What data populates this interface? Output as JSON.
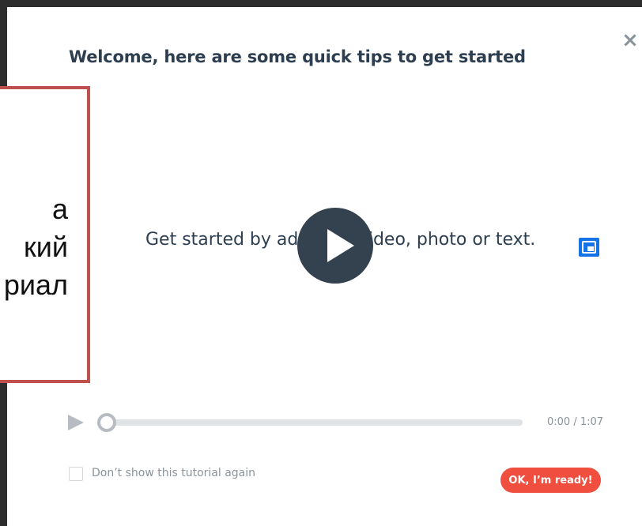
{
  "modal": {
    "title": "Welcome, here are some quick tips to get started",
    "close_icon": "close-icon"
  },
  "video": {
    "caption": "Get started by adding a video, photo or text.",
    "play_icon": "play-icon",
    "pip_icon": "picture-in-picture-icon",
    "progress": 0,
    "time": "0:00 / 1:07"
  },
  "overlay": {
    "text": "а\nкий\nриал",
    "border_color": "#c0504d"
  },
  "footer": {
    "checkbox_label": "Don’t show this tutorial again",
    "ok_label": "OK, I’m ready!"
  },
  "colors": {
    "accent": "#f04e3e",
    "title": "#2c3e50",
    "pip": "#1473e6"
  }
}
